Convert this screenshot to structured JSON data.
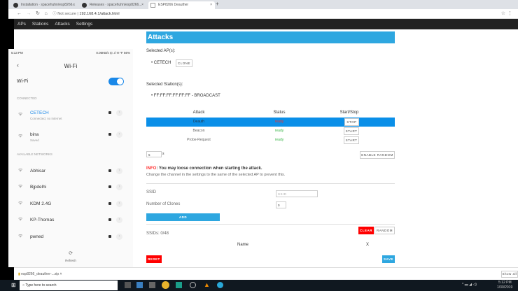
{
  "browser": {
    "tabs": [
      {
        "label": "Installation · spacehuhn/esp8266..."
      },
      {
        "label": "Releases · spacehuhn/esp8266..."
      },
      {
        "label": "ESP8266 Deauther",
        "active": true
      }
    ],
    "security": "Not secure",
    "url": "192.168.4.1/attack.html"
  },
  "nav": [
    "APs",
    "Stations",
    "Attacks",
    "Settings"
  ],
  "page": {
    "title": "Attacks",
    "selected_aps_label": "Selected AP(s):",
    "ap": "CETECH",
    "clone": "CLONE",
    "selected_stations_label": "Selected Station(s):",
    "station": "FF:FF:FF:FF:FF:FF - BROADCAST",
    "table": {
      "headers": [
        "Attack",
        "Status",
        "Start/Stop"
      ],
      "rows": [
        {
          "attack": "Deauth",
          "status": "ready",
          "button": "STOP",
          "active": true
        },
        {
          "attack": "Beacon",
          "status": "ready",
          "button": "START"
        },
        {
          "attack": "Probe-Request",
          "status": "ready",
          "button": "START"
        }
      ]
    },
    "interval_value": "5",
    "interval_unit": "s",
    "enable_random": "ENABLE RANDOM",
    "info_prefix": "INFO",
    "info_bold": ": You may loose connection when starting the attack.",
    "info_text": "Change the channel in the settings to the same of the selected AP to prevent this.",
    "ssid_label": "SSID",
    "ssid_placeholder": "SSID",
    "clones_label": "Number of Clones",
    "clones_value": "0",
    "add": "ADD",
    "ssids_count": "SSIDs: 0/48",
    "clear": "CLEAR",
    "random": "RANDOM",
    "name_header": "Name",
    "x_header": "X",
    "reset": "RESET",
    "save": "SAVE"
  },
  "phone": {
    "time": "5:13 PM",
    "status": "0.06KB/s ⊡ .ıl ✉ ᯤ 56%",
    "title": "Wi-Fi",
    "wifi_label": "Wi-Fi",
    "wifi_on": true,
    "connected_label": "CONNECTED",
    "connected": [
      {
        "name": "CETECH",
        "sub": "Connected, no internet"
      },
      {
        "name": "bina",
        "sub": "Saved"
      }
    ],
    "available_label": "AVAILABLE NETWORKS",
    "available": [
      "Abhisar",
      "Bjpdelhi",
      "KDM 2.4G",
      "KP-Thomas",
      "pwned"
    ],
    "refresh": "Refresh"
  },
  "download": {
    "file": "esp8266_deauther-...zip",
    "show_all": "Show all"
  },
  "taskbar": {
    "search": "Type here to search",
    "time": "5:12 PM",
    "date": "1/30/2019"
  },
  "colors": {
    "accent": "#2ea7e0",
    "danger": "#ff0000",
    "ready": "#3bb54a"
  }
}
